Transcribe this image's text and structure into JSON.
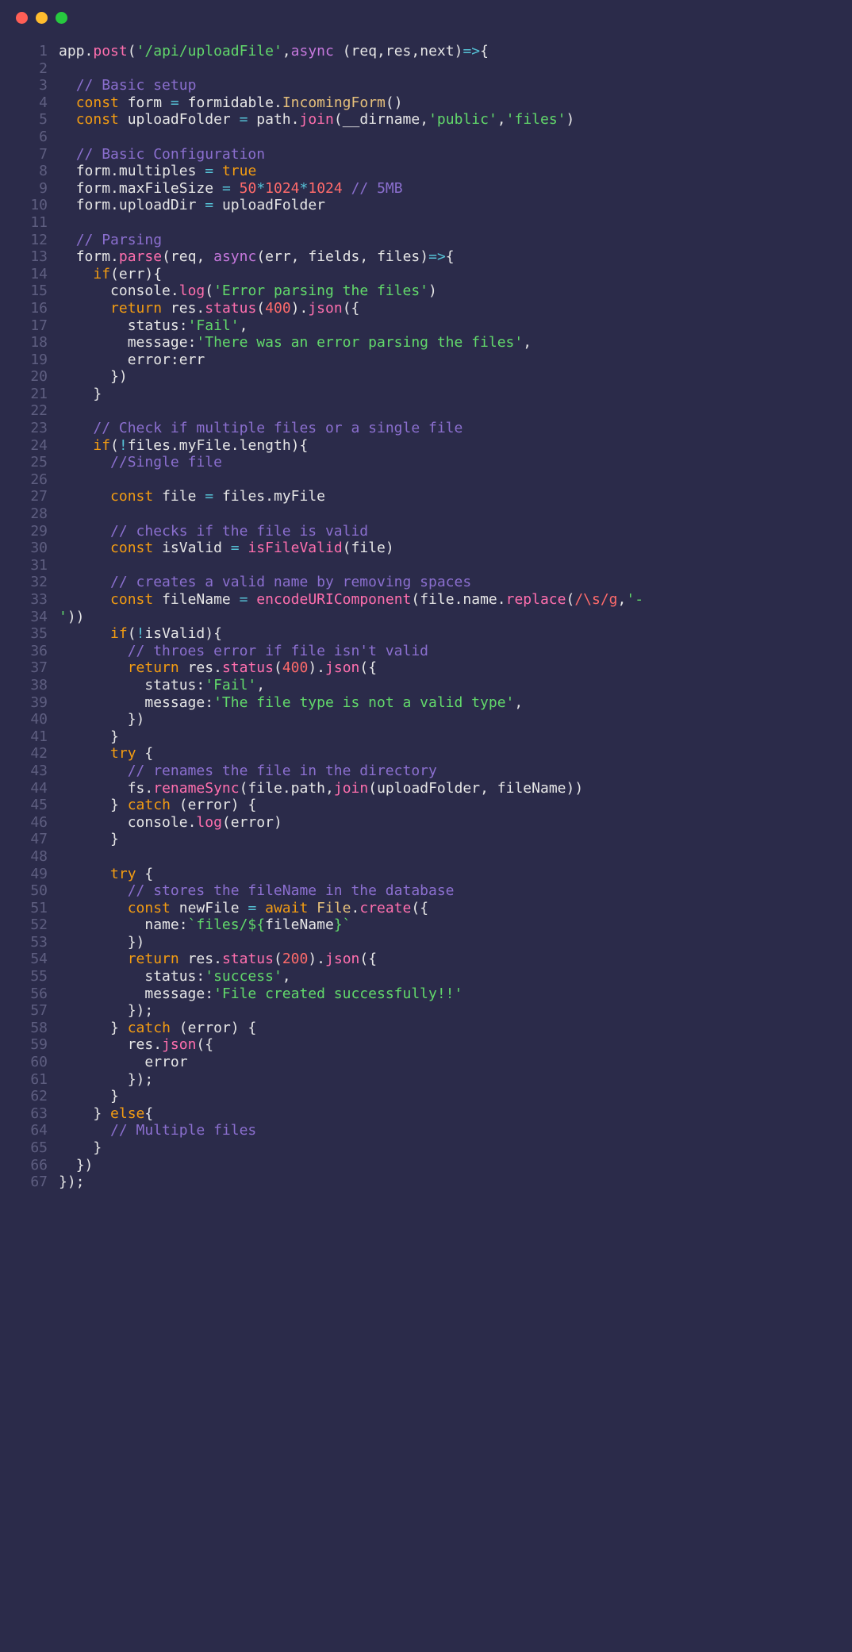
{
  "window": {
    "traffic": [
      "red",
      "yellow",
      "green"
    ]
  },
  "code_language": "javascript",
  "lines": [
    {
      "n": 1,
      "html": "<span class='c-obj'>app</span><span class='c-punc'>.</span><span class='c-fn'>post</span><span class='c-punc'>(</span><span class='c-str'>'/api/uploadFile'</span><span class='c-punc'>,</span><span class='c-async'>async</span> <span class='c-punc'>(</span><span class='c-obj'>req</span><span class='c-punc'>,</span><span class='c-obj'>res</span><span class='c-punc'>,</span><span class='c-obj'>next</span><span class='c-punc'>)</span><span class='c-op'>=&gt;</span><span class='c-punc'>{</span>"
    },
    {
      "n": 2,
      "html": ""
    },
    {
      "n": 3,
      "html": "  <span class='c-cmt'>// Basic setup</span>"
    },
    {
      "n": 4,
      "html": "  <span class='c-kw'>const</span> <span class='c-obj'>form</span> <span class='c-op'>=</span> <span class='c-obj'>formidable</span><span class='c-punc'>.</span><span class='c-type'>IncomingForm</span><span class='c-punc'>()</span>"
    },
    {
      "n": 5,
      "html": "  <span class='c-kw'>const</span> <span class='c-obj'>uploadFolder</span> <span class='c-op'>=</span> <span class='c-obj'>path</span><span class='c-punc'>.</span><span class='c-fn'>join</span><span class='c-punc'>(</span><span class='c-obj'>__dirname</span><span class='c-punc'>,</span><span class='c-str'>'public'</span><span class='c-punc'>,</span><span class='c-str'>'files'</span><span class='c-punc'>)</span>"
    },
    {
      "n": 6,
      "html": ""
    },
    {
      "n": 7,
      "html": "  <span class='c-cmt'>// Basic Configuration</span>"
    },
    {
      "n": 8,
      "html": "  <span class='c-obj'>form</span><span class='c-punc'>.</span><span class='c-obj'>multiples</span> <span class='c-op'>=</span> <span class='c-bool'>true</span>"
    },
    {
      "n": 9,
      "html": "  <span class='c-obj'>form</span><span class='c-punc'>.</span><span class='c-obj'>maxFileSize</span> <span class='c-op'>=</span> <span class='c-num'>50</span><span class='c-op'>*</span><span class='c-num'>1024</span><span class='c-op'>*</span><span class='c-num'>1024</span> <span class='c-cmt'>// 5MB</span>"
    },
    {
      "n": 10,
      "html": "  <span class='c-obj'>form</span><span class='c-punc'>.</span><span class='c-obj'>uploadDir</span> <span class='c-op'>=</span> <span class='c-obj'>uploadFolder</span>"
    },
    {
      "n": 11,
      "html": ""
    },
    {
      "n": 12,
      "html": "  <span class='c-cmt'>// Parsing</span>"
    },
    {
      "n": 13,
      "html": "  <span class='c-obj'>form</span><span class='c-punc'>.</span><span class='c-fn'>parse</span><span class='c-punc'>(</span><span class='c-obj'>req</span><span class='c-punc'>,</span> <span class='c-async'>async</span><span class='c-punc'>(</span><span class='c-obj'>err</span><span class='c-punc'>,</span> <span class='c-obj'>fields</span><span class='c-punc'>,</span> <span class='c-obj'>files</span><span class='c-punc'>)</span><span class='c-op'>=&gt;</span><span class='c-punc'>{</span>"
    },
    {
      "n": 14,
      "html": "    <span class='c-kw'>if</span><span class='c-punc'>(</span><span class='c-obj'>err</span><span class='c-punc'>){</span>"
    },
    {
      "n": 15,
      "html": "      <span class='c-obj'>console</span><span class='c-punc'>.</span><span class='c-fn'>log</span><span class='c-punc'>(</span><span class='c-str'>'Error parsing the files'</span><span class='c-punc'>)</span>"
    },
    {
      "n": 16,
      "html": "      <span class='c-kw'>return</span> <span class='c-obj'>res</span><span class='c-punc'>.</span><span class='c-fn'>status</span><span class='c-punc'>(</span><span class='c-num'>400</span><span class='c-punc'>).</span><span class='c-fn'>json</span><span class='c-punc'>({</span>"
    },
    {
      "n": 17,
      "html": "        <span class='c-obj'>status</span><span class='c-punc'>:</span><span class='c-str'>'Fail'</span><span class='c-punc'>,</span>"
    },
    {
      "n": 18,
      "html": "        <span class='c-obj'>message</span><span class='c-punc'>:</span><span class='c-str'>'There was an error parsing the files'</span><span class='c-punc'>,</span>"
    },
    {
      "n": 19,
      "html": "        <span class='c-obj'>error</span><span class='c-punc'>:</span><span class='c-obj'>err</span>"
    },
    {
      "n": 20,
      "html": "      <span class='c-punc'>})</span>"
    },
    {
      "n": 21,
      "html": "    <span class='c-punc'>}</span>"
    },
    {
      "n": 22,
      "html": ""
    },
    {
      "n": 23,
      "html": "    <span class='c-cmt'>// Check if multiple files or a single file</span>"
    },
    {
      "n": 24,
      "html": "    <span class='c-kw'>if</span><span class='c-punc'>(</span><span class='c-op'>!</span><span class='c-obj'>files</span><span class='c-punc'>.</span><span class='c-obj'>myFile</span><span class='c-punc'>.</span><span class='c-obj'>length</span><span class='c-punc'>){</span>"
    },
    {
      "n": 25,
      "html": "      <span class='c-cmt'>//Single file</span>"
    },
    {
      "n": 26,
      "html": ""
    },
    {
      "n": 27,
      "html": "      <span class='c-kw'>const</span> <span class='c-obj'>file</span> <span class='c-op'>=</span> <span class='c-obj'>files</span><span class='c-punc'>.</span><span class='c-obj'>myFile</span>"
    },
    {
      "n": 28,
      "html": ""
    },
    {
      "n": 29,
      "html": "      <span class='c-cmt'>// checks if the file is valid</span>"
    },
    {
      "n": 30,
      "html": "      <span class='c-kw'>const</span> <span class='c-obj'>isValid</span> <span class='c-op'>=</span> <span class='c-fn'>isFileValid</span><span class='c-punc'>(</span><span class='c-obj'>file</span><span class='c-punc'>)</span>"
    },
    {
      "n": 31,
      "html": ""
    },
    {
      "n": 32,
      "html": "      <span class='c-cmt'>// creates a valid name by removing spaces</span>"
    },
    {
      "n": 33,
      "html": "      <span class='c-kw'>const</span> <span class='c-obj'>fileName</span> <span class='c-op'>=</span> <span class='c-fn'>encodeURIComponent</span><span class='c-punc'>(</span><span class='c-obj'>file</span><span class='c-punc'>.</span><span class='c-obj'>name</span><span class='c-punc'>.</span><span class='c-fn'>replace</span><span class='c-punc'>(</span><span class='c-regex'>/\\s/g</span><span class='c-punc'>,</span><span class='c-str'>'-</span>"
    },
    {
      "n": 34,
      "html": "<span class='c-str'>'</span><span class='c-punc'>))</span>"
    },
    {
      "n": 35,
      "html": "      <span class='c-kw'>if</span><span class='c-punc'>(</span><span class='c-op'>!</span><span class='c-obj'>isValid</span><span class='c-punc'>){</span>"
    },
    {
      "n": 36,
      "html": "        <span class='c-cmt'>// throes error if file isn't valid</span>"
    },
    {
      "n": 37,
      "html": "        <span class='c-kw'>return</span> <span class='c-obj'>res</span><span class='c-punc'>.</span><span class='c-fn'>status</span><span class='c-punc'>(</span><span class='c-num'>400</span><span class='c-punc'>).</span><span class='c-fn'>json</span><span class='c-punc'>({</span>"
    },
    {
      "n": 38,
      "html": "          <span class='c-obj'>status</span><span class='c-punc'>:</span><span class='c-str'>'Fail'</span><span class='c-punc'>,</span>"
    },
    {
      "n": 39,
      "html": "          <span class='c-obj'>message</span><span class='c-punc'>:</span><span class='c-str'>'The file type is not a valid type'</span><span class='c-punc'>,</span>"
    },
    {
      "n": 40,
      "html": "        <span class='c-punc'>})</span>"
    },
    {
      "n": 41,
      "html": "      <span class='c-punc'>}</span>"
    },
    {
      "n": 42,
      "html": "      <span class='c-kw'>try</span> <span class='c-punc'>{</span>"
    },
    {
      "n": 43,
      "html": "        <span class='c-cmt'>// renames the file in the directory</span>"
    },
    {
      "n": 44,
      "html": "        <span class='c-obj'>fs</span><span class='c-punc'>.</span><span class='c-fn'>renameSync</span><span class='c-punc'>(</span><span class='c-obj'>file</span><span class='c-punc'>.</span><span class='c-obj'>path</span><span class='c-punc'>,</span><span class='c-fn'>join</span><span class='c-punc'>(</span><span class='c-obj'>uploadFolder</span><span class='c-punc'>,</span> <span class='c-obj'>fileName</span><span class='c-punc'>))</span>"
    },
    {
      "n": 45,
      "html": "      <span class='c-punc'>}</span> <span class='c-kw'>catch</span> <span class='c-punc'>(</span><span class='c-obj'>error</span><span class='c-punc'>) {</span>"
    },
    {
      "n": 46,
      "html": "        <span class='c-obj'>console</span><span class='c-punc'>.</span><span class='c-fn'>log</span><span class='c-punc'>(</span><span class='c-obj'>error</span><span class='c-punc'>)</span>"
    },
    {
      "n": 47,
      "html": "      <span class='c-punc'>}</span>"
    },
    {
      "n": 48,
      "html": ""
    },
    {
      "n": 49,
      "html": "      <span class='c-kw'>try</span> <span class='c-punc'>{</span>"
    },
    {
      "n": 50,
      "html": "        <span class='c-cmt'>// stores the fileName in the database</span>"
    },
    {
      "n": 51,
      "html": "        <span class='c-kw'>const</span> <span class='c-obj'>newFile</span> <span class='c-op'>=</span> <span class='c-kw'>await</span> <span class='c-type'>File</span><span class='c-punc'>.</span><span class='c-fn'>create</span><span class='c-punc'>({</span>"
    },
    {
      "n": 52,
      "html": "          <span class='c-obj'>name</span><span class='c-punc'>:</span><span class='c-str'>`files/${</span><span class='c-obj'>fileName</span><span class='c-str'>}`</span>"
    },
    {
      "n": 53,
      "html": "        <span class='c-punc'>})</span>"
    },
    {
      "n": 54,
      "html": "        <span class='c-kw'>return</span> <span class='c-obj'>res</span><span class='c-punc'>.</span><span class='c-fn'>status</span><span class='c-punc'>(</span><span class='c-num'>200</span><span class='c-punc'>).</span><span class='c-fn'>json</span><span class='c-punc'>({</span>"
    },
    {
      "n": 55,
      "html": "          <span class='c-obj'>status</span><span class='c-punc'>:</span><span class='c-str'>'success'</span><span class='c-punc'>,</span>"
    },
    {
      "n": 56,
      "html": "          <span class='c-obj'>message</span><span class='c-punc'>:</span><span class='c-str'>'File created successfully!!'</span>"
    },
    {
      "n": 57,
      "html": "        <span class='c-punc'>});</span>"
    },
    {
      "n": 58,
      "html": "      <span class='c-punc'>}</span> <span class='c-kw'>catch</span> <span class='c-punc'>(</span><span class='c-obj'>error</span><span class='c-punc'>) {</span>"
    },
    {
      "n": 59,
      "html": "        <span class='c-obj'>res</span><span class='c-punc'>.</span><span class='c-fn'>json</span><span class='c-punc'>({</span>"
    },
    {
      "n": 60,
      "html": "          <span class='c-obj'>error</span>"
    },
    {
      "n": 61,
      "html": "        <span class='c-punc'>});</span>"
    },
    {
      "n": 62,
      "html": "      <span class='c-punc'>}</span>"
    },
    {
      "n": 63,
      "html": "    <span class='c-punc'>}</span> <span class='c-kw'>else</span><span class='c-punc'>{</span>"
    },
    {
      "n": 64,
      "html": "      <span class='c-cmt'>// Multiple files</span>"
    },
    {
      "n": 65,
      "html": "    <span class='c-punc'>}</span>"
    },
    {
      "n": 66,
      "html": "  <span class='c-punc'>})</span>"
    },
    {
      "n": 67,
      "html": "<span class='c-punc'>});</span>"
    }
  ]
}
